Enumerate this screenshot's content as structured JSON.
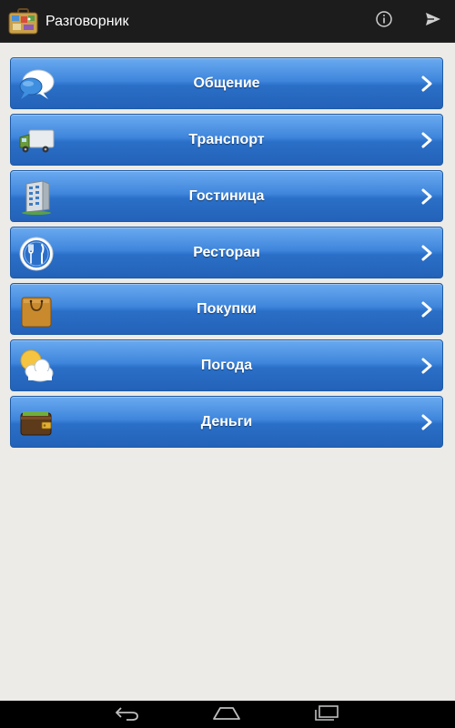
{
  "action_bar": {
    "title": "Разговорник",
    "app_icon": "suitcase-icon",
    "actions": [
      {
        "name": "info",
        "icon": "info-icon"
      },
      {
        "name": "share",
        "icon": "send-icon"
      }
    ]
  },
  "categories": [
    {
      "label": "Общение",
      "icon": "speech-bubble-icon"
    },
    {
      "label": "Транспорт",
      "icon": "truck-icon"
    },
    {
      "label": "Гостиница",
      "icon": "hotel-building-icon"
    },
    {
      "label": "Ресторан",
      "icon": "fork-knife-icon"
    },
    {
      "label": "Покупки",
      "icon": "shopping-bag-icon"
    },
    {
      "label": "Погода",
      "icon": "sun-cloud-icon"
    },
    {
      "label": "Деньги",
      "icon": "wallet-icon"
    }
  ],
  "nav_bar": {
    "buttons": [
      {
        "name": "back",
        "icon": "back-icon"
      },
      {
        "name": "home",
        "icon": "home-icon"
      },
      {
        "name": "recents",
        "icon": "recents-icon"
      }
    ]
  },
  "colors": {
    "action_bar_bg": "#1c1c1c",
    "page_bg": "#ecebe7",
    "row_gradient_top": "#6aaaf0",
    "row_gradient_bottom": "#2462b8",
    "row_text": "#ffffff"
  }
}
